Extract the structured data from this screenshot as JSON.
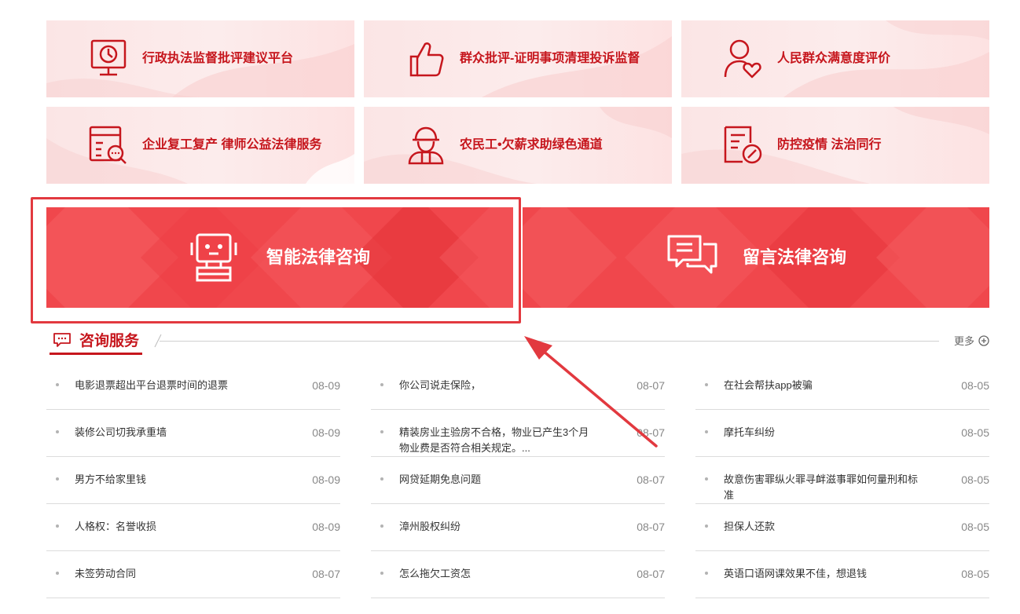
{
  "tiles": [
    {
      "label": "行政执法监督批评建议平台",
      "icon": "monitor-clock-icon"
    },
    {
      "label": "群众批评-证明事项清理投诉监督",
      "icon": "thumbs-up-icon"
    },
    {
      "label": "人民群众满意度评价",
      "icon": "person-heart-icon"
    },
    {
      "label": "企业复工复产 律师公益法律服务",
      "icon": "document-search-icon"
    },
    {
      "label": "农民工•欠薪求助绿色通道",
      "icon": "worker-icon"
    },
    {
      "label": "防控疫情 法治同行",
      "icon": "document-ban-icon"
    }
  ],
  "banners": {
    "smart": {
      "label": "智能法律咨询",
      "icon": "robot-icon"
    },
    "message": {
      "label": "留言法律咨询",
      "icon": "chat-bubbles-icon"
    }
  },
  "section": {
    "title": "咨询服务",
    "more": "更多"
  },
  "colors": {
    "brand_red": "#c6161d",
    "banner_red": "#f0474c",
    "tile_bg": "#fbe5e5"
  },
  "lists": [
    [
      {
        "title": "电影退票超出平台退票时间的退票",
        "date": "08-09"
      },
      {
        "title": "装修公司切我承重墙",
        "date": "08-09"
      },
      {
        "title": "男方不给家里钱",
        "date": "08-09"
      },
      {
        "title": "人格权：名誉收损",
        "date": "08-09"
      },
      {
        "title": "未签劳动合同",
        "date": "08-07"
      }
    ],
    [
      {
        "title": "你公司说走保险，",
        "date": "08-07"
      },
      {
        "title": "精装房业主验房不合格，物业已产生3个月物业费是否符合相关规定。...",
        "date": "08-07"
      },
      {
        "title": "网贷延期免息问题",
        "date": "08-07"
      },
      {
        "title": "漳州股权纠纷",
        "date": "08-07"
      },
      {
        "title": "怎么拖欠工资怎",
        "date": "08-07"
      }
    ],
    [
      {
        "title": "在社会帮扶app被骗",
        "date": "08-05"
      },
      {
        "title": "摩托车纠纷",
        "date": "08-05"
      },
      {
        "title": "故意伤害罪纵火罪寻衅滋事罪如何量刑和标准",
        "date": "08-05"
      },
      {
        "title": "担保人还款",
        "date": "08-05"
      },
      {
        "title": "英语口语网课效果不佳，想退钱",
        "date": "08-05"
      }
    ]
  ]
}
